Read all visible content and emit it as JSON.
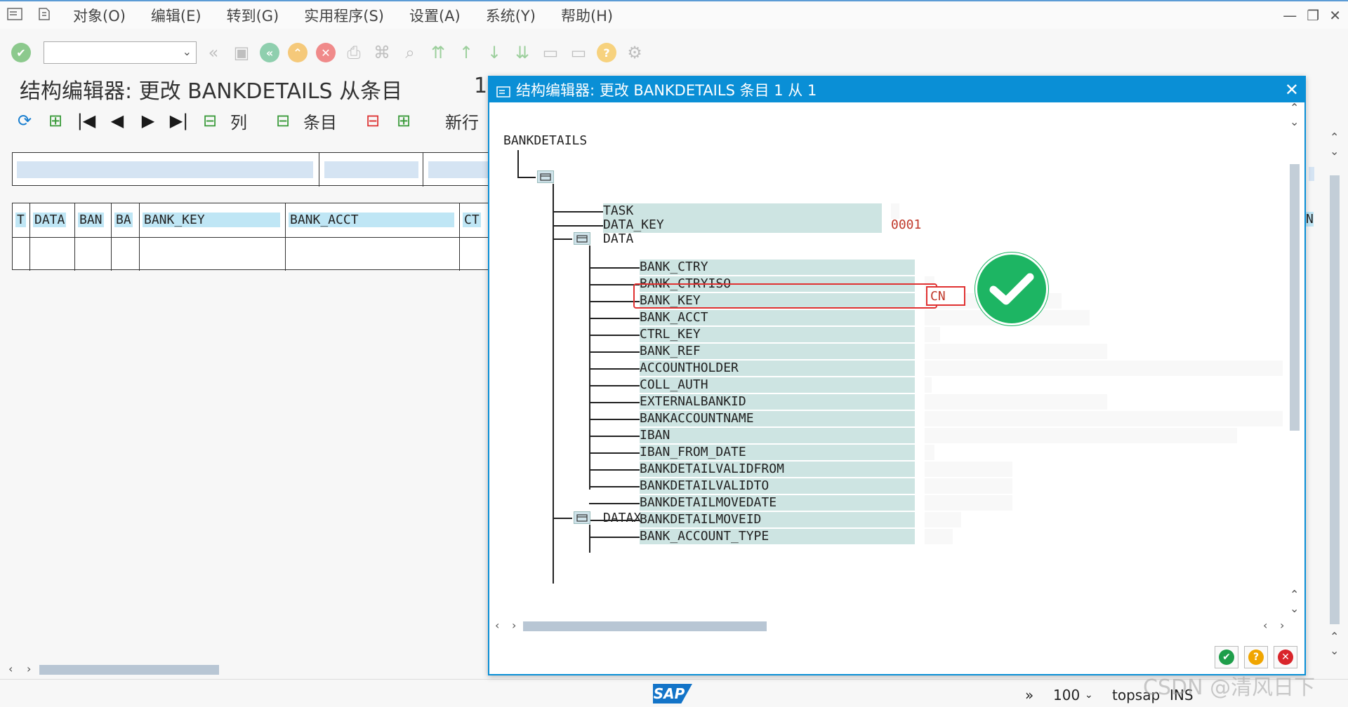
{
  "menu": {
    "items": [
      "对象(O)",
      "编辑(E)",
      "转到(G)",
      "实用程序(S)",
      "设置(A)",
      "系统(Y)",
      "帮助(H)"
    ]
  },
  "title": {
    "text": "结构编辑器: 更改 BANKDETAILS 从条目",
    "number": "1"
  },
  "app_toolbar": {
    "column_label": "列",
    "entry_label": "条目",
    "newline_label": "新行"
  },
  "background_table": {
    "headers": [
      "T",
      "DATA",
      "BAN",
      "BA",
      "BANK_KEY",
      "BANK_ACCT",
      "CT"
    ],
    "partial_header": "N"
  },
  "dialog": {
    "title": "结构编辑器: 更改 BANKDETAILS 条目 1 从 1",
    "root": "BANKDETAILS",
    "task_label": "TASK",
    "data_key_label": "DATA_KEY",
    "data_key_value": "0001",
    "data_label": "DATA",
    "fields": [
      "BANK_CTRY",
      "BANK_CTRYISO",
      "BANK_KEY",
      "BANK_ACCT",
      "CTRL_KEY",
      "BANK_REF",
      "ACCOUNTHOLDER",
      "COLL_AUTH",
      "EXTERNALBANKID",
      "BANKACCOUNTNAME",
      "IBAN",
      "IBAN_FROM_DATE",
      "BANKDETAILVALIDFROM",
      "BANKDETAILVALIDTO",
      "BANKDETAILMOVEDATE",
      "BANKDETAILMOVEID",
      "BANK_ACCOUNT_TYPE"
    ],
    "bank_ctry_value": "CN",
    "datax_label": "DATAX"
  },
  "status": {
    "zoom": "100",
    "system": "topsap",
    "mode": "INS"
  },
  "watermark": "CSDN @清风日下",
  "colors": {
    "accent": "#0a8fd6",
    "field_bg": "#cde4e2",
    "value_red": "#c0392b",
    "highlight": "#e03131",
    "check_green": "#1db563"
  }
}
